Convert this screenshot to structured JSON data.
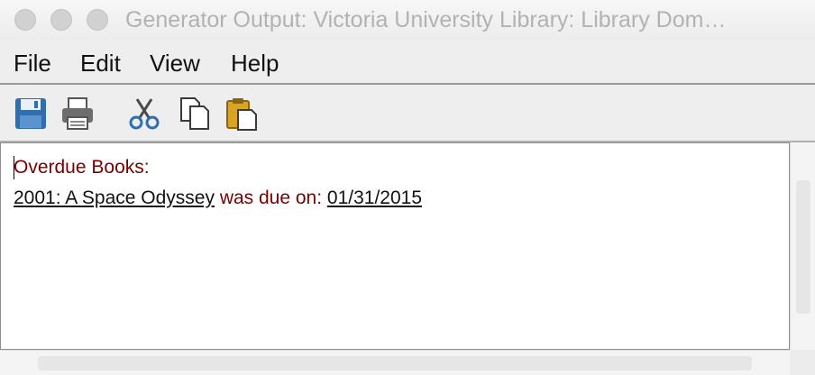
{
  "window": {
    "title": "Generator Output: Victoria University Library: Library Dom…"
  },
  "menu": {
    "items": [
      "File",
      "Edit",
      "View",
      "Help"
    ]
  },
  "toolbar": {
    "icons": [
      "save-icon",
      "print-icon",
      "cut-icon",
      "copy-icon",
      "paste-icon"
    ]
  },
  "content": {
    "heading": "Overdue Books:",
    "book_title": "2001: A Space Odyssey",
    "due_text": " was due on: ",
    "due_date": "01/31/2015"
  },
  "colors": {
    "heading_text": "#7a0000",
    "save_icon": "#2f6fb0"
  }
}
